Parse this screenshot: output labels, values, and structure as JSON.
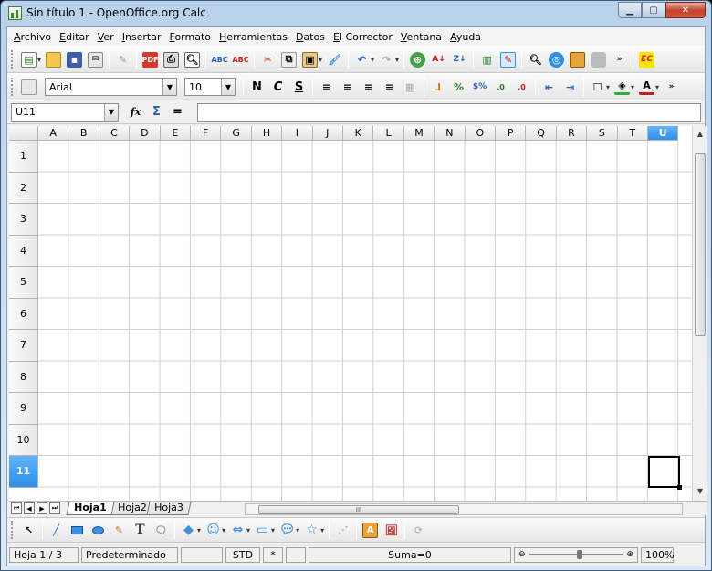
{
  "window": {
    "title": "Sin título 1 - OpenOffice.org Calc"
  },
  "menu": [
    "Archivo",
    "Editar",
    "Ver",
    "Insertar",
    "Formato",
    "Herramientas",
    "Datos",
    "El Corrector",
    "Ventana",
    "Ayuda"
  ],
  "format_toolbar": {
    "font_name": "Arial",
    "font_size": "10",
    "bold": "N",
    "italic": "C",
    "underline": "S"
  },
  "formula_bar": {
    "name_box": "U11",
    "fx": "fx",
    "sum": "Σ",
    "equals": "=",
    "content": ""
  },
  "grid": {
    "columns": [
      "A",
      "B",
      "C",
      "D",
      "E",
      "F",
      "G",
      "H",
      "I",
      "J",
      "K",
      "L",
      "M",
      "N",
      "O",
      "P",
      "Q",
      "R",
      "S",
      "T",
      "U"
    ],
    "rows": [
      "1",
      "2",
      "3",
      "4",
      "5",
      "6",
      "7",
      "8",
      "9",
      "10",
      "11"
    ],
    "selected_column": "U",
    "selected_row": "11"
  },
  "sheet_tabs": [
    "Hoja1",
    "Hoja2",
    "Hoja3"
  ],
  "hscroll_label": "III",
  "status": {
    "sheet": "Hoja 1 / 3",
    "style": "Predeterminado",
    "mode": "STD",
    "modified": "*",
    "sum": "Suma=0",
    "zoom": "100%"
  },
  "icon_colors": {
    "accent_blue": "#3f8fe0",
    "ec_yellow": "#f7e40a",
    "ec_red": "#e02020"
  }
}
